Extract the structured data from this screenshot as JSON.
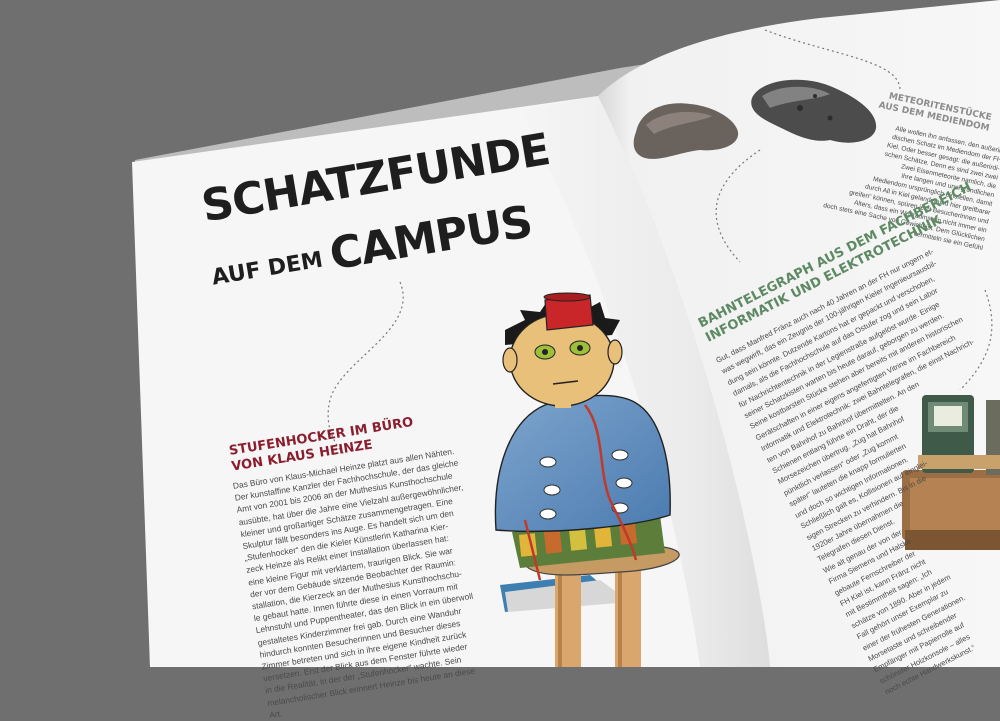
{
  "colors": {
    "background": "#6f6f70",
    "page": "#f7f7f7",
    "title": "#1e1e1e",
    "heading_red": "#8b1e2e",
    "heading_green": "#5d8a63"
  },
  "left_page": {
    "title_line1": "SCHATZFUNDE",
    "title_line2_small": "AUF DEM",
    "title_line2_big": "CAMPUS",
    "section_heading": [
      "STUFENHOCKER IM BÜRO",
      "VON KLAUS HEINZE"
    ],
    "section_body": [
      "Das Büro von Klaus-Michael Heinze platzt aus allen Nähten.",
      "Der kunstaffine Kanzler der Fachhochschule, der das gleiche",
      "Amt von 2001 bis 2006 an der Muthesius Kunsthochschule",
      "ausübte, hat über die Jahre eine Vielzahl außergewöhnlicher,",
      "kleiner und großartiger Schätze zusammengetragen. Eine",
      "Skulptur fällt besonders ins Auge. Es handelt sich um den",
      "„Stufenhocker“ den die Kieler Künstlerin Katharina Kier-",
      "zeck Heinze als Relikt einer Installation überlassen hat:",
      "eine kleine Figur mit verklärtem, traurigen Blick. Sie war",
      "der vor dem Gebäude sitzende Beobachter der Rauminː",
      "stallation, die Kierzeck an der Muthesius Kunsthochschu-",
      "le gebaut hatte. Innen führte diese in einen Vorraum mit",
      "Lehnstuhl und Puppentheater, das den Blick in ein überwoll",
      "gestaltetes Kinderzimmer frei gab. Durch eine Wanduhr",
      "hindurch konnten Besucherinnen und Besucher dieses",
      "Zimmer betreten und sich in ihre eigene Kindheit zurück",
      "versetzen. Erst der Blick aus dem Fenster führte wieder",
      "in die Realität, in der der „Stufenhocker“ wachte. Sein",
      "melancholischer Blick erinnert Heinze bis heute an diese",
      "Art."
    ]
  },
  "right_page": {
    "meteor_heading": [
      "METEORITENSTÜCKE",
      "AUS DEM MEDIENDOM"
    ],
    "meteor_body": [
      "Alle wollen ihn anfassen, den außerir-",
      "dischen Schatz im Mediendom der FH",
      "Kiel. Oder besser gesagt: die außerirdi-",
      "schen Schätze. Denn es sind zwei zwei",
      "Zwei Eisenmeteorite namlich, die",
      "ihre langen und unergründlichen",
      "Mediendom ursprünglich einstellen, damit",
      "durch All in Kiel gelandet und hier greifbarer",
      "greifen“ können, spüren jetzt Besucherinnen und",
      "Alters, dass ein Weltraumstein nicht immer ein",
      "doch stets eine Sache von Gewicht ist. Dem Glücklichen",
      "vermitteln sie ein Gefühl"
    ],
    "telegraph_heading": [
      "BAHNTELEGRAPH AUS DEM FACHBEREICH",
      "INFORMATIK UND ELEKTROTECHNIK"
    ],
    "telegraph_body": [
      "Gut, dass Manfred Fränz auch nach 40 Jahren an der FH nur ungern et-",
      "was wegwirft, das ein Zeugnis der 100-jährigen Kieler Ingenieursausbil-",
      "dung sein könnte. Dutzende Kartons hat er gepackt und verschoben,",
      "damals, als die Fachhochschule auf das Ostufer zog und sein Labor",
      "für Nachrichtentechnik in der Legienstraße aufgelöst wurde. Einige",
      "seiner Schatzkisten warten bis heute darauf, geborgen zu werden.",
      "Seine kostbarsten Stücke stehen aber bereits mit anderen historischen",
      "Gerätschaften in einer eigens angefertigten Vitrine im Fachbereich",
      "Informatik und Elektrotechnik: zwei Bahntelegrafen, die einst Nachrich-",
      "ten von Bahnhof zu Bahnhof übermittelten. An den",
      "Schienen entlang führte ein Draht, der die",
      "Morsezeichen übertrug. „Zug hat Bahnhof",
      "pünktlich verlassen“ oder „Zug kommt",
      "später“ lauteten die knapp formulierten",
      "und doch so wichtigen Informationen.",
      "Schließlich galt es, Kollisionen auf einglei-",
      "sigen Strecken zu verhindern. Bis in die",
      "1920er Jahre übernahmen die",
      "Telegrafen diesen Dienst.",
      "Wie alt genau der von der",
      "Firma Siemens und Halske",
      "gebaute Fernschreiber der",
      "FH Kiel ist, kann Fränz nicht",
      "mit Bestimmtheit sagen: „Ich",
      "schätze von 1890. Aber in jedem",
      "Fall gehört unser Exemplar zu",
      "einer der frühesten Generationen.",
      "Morsetaste und schreibender",
      "Empfänger mit Papierrolle auf",
      "schönster Holzkonsole – alles",
      "noch echte Handwerkskunst.“"
    ]
  }
}
